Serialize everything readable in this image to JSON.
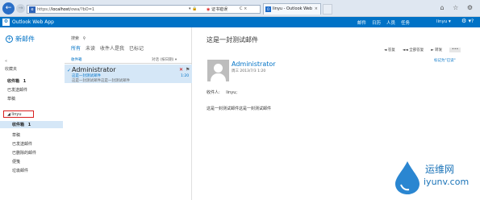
{
  "browser": {
    "back_icon": "back-arrow-icon",
    "url_scheme": "https://",
    "url_host": "localhost",
    "url_path": "/owa/?bO=1",
    "addr_icons": "▾ 🔒",
    "cert_label": "证书错误",
    "addr_tail": "C ×",
    "tab_title": "linyu - Outlook Web App",
    "tab_close": "×",
    "chrome_icons": "⌂ ☆ ⚙"
  },
  "owa": {
    "app_title": "Outlook Web App",
    "logo_letter": "O",
    "nav": [
      "邮件",
      "日历",
      "人员",
      "任务"
    ],
    "user_name": "linyu ▾",
    "gear": "⚙ ▾",
    "help": "?"
  },
  "folders": {
    "new_mail_plus": "+",
    "new_mail_label": "新邮件",
    "collapse": "«",
    "favorites_title": "收藏夹",
    "favorites": [
      {
        "label": "收件箱",
        "count": "1"
      },
      {
        "label": "已发送邮件"
      },
      {
        "label": "草稿"
      }
    ],
    "account_label": "◢ linyu",
    "account_folders": [
      {
        "label": "收件箱",
        "count": "1"
      },
      {
        "label": "草稿"
      },
      {
        "label": "已发送邮件"
      },
      {
        "label": "已删除的邮件"
      },
      {
        "label": "便笺"
      },
      {
        "label": "垃圾邮件"
      }
    ]
  },
  "list": {
    "search_label": "搜索",
    "search_icon": "⚲",
    "filters": [
      "所有",
      "未读",
      "收件人是我",
      "已标记"
    ],
    "heading": "收件箱",
    "sort_label": "对话 (按日期) ▾",
    "message": {
      "check": "✓",
      "sender": "Administrator",
      "subject": "这是一封测试邮件",
      "preview": "这是一封测试邮件这是一封测试邮件",
      "delete": "✕",
      "flag": "⚑",
      "time": "1:20"
    }
  },
  "reading": {
    "subject": "这是一封测试邮件",
    "actions": [
      "◄ 答复",
      "◄◄ 全部答复",
      "► 转发"
    ],
    "more": "•••",
    "mark_unread": "标记为\"已读\"",
    "from": "Administrator",
    "date": "周三 2013/7/3 1:20",
    "to_label": "收件人:",
    "to_name": "linyu;",
    "body": "这是一封测试邮件这是一封测试邮件"
  },
  "watermark": {
    "cn": "运维网",
    "en": "iyunv.com"
  }
}
